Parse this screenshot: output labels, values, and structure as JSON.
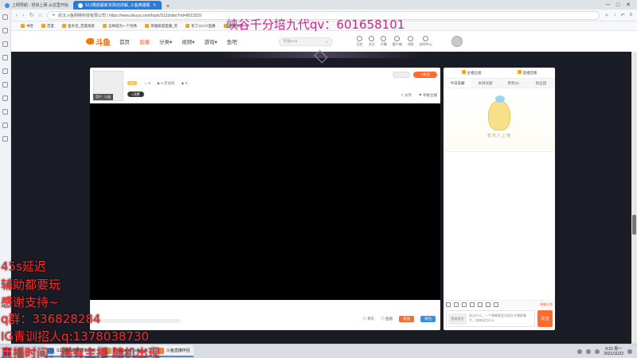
{
  "browser": {
    "tabs": [
      {
        "label": "上网导航 - 轻快上网 从这里开始",
        "active": false
      },
      {
        "label": "S12赛前最新本改动详解_斗鱼英雄联",
        "active": true
      }
    ],
    "new_tab": "+",
    "window_controls": [
      "─",
      "□",
      "✕"
    ],
    "url": "武汉斗鱼网络科技有限公司 | https://www.douyu.com/topic/S12zhibo?rid=8011529",
    "bookmarks": [
      "书签",
      "百度",
      "金木坚_百度搜索",
      "怎样成为一个优秀",
      "英雄联盟直播_英",
      "有了zzz'LT直播",
      "英雄联盟"
    ]
  },
  "overlay_title": "峡谷千分培九代qv：601658101",
  "site": {
    "logo": "斗鱼",
    "nav": [
      {
        "label": "首页",
        "active": false
      },
      {
        "label": "直播",
        "active": true
      },
      {
        "label": "分类▾",
        "active": false
      },
      {
        "label": "视频▾",
        "active": false
      },
      {
        "label": "游戏▾",
        "active": false
      },
      {
        "label": "鱼吧",
        "active": false
      }
    ],
    "search_placeholder": "阿福sma",
    "tools": [
      "历史",
      "关注",
      "开播",
      "客户端",
      "消息",
      "创作中心"
    ]
  },
  "player": {
    "host_tag": "用户",
    "host_tag2": "公益",
    "level": "LV.5",
    "stats": {
      "hot": "0",
      "followers": "0 次访问",
      "online": "0"
    },
    "vip_tag": "V消费",
    "follow_btn": "+关注",
    "share": "分享",
    "report": "举报主播",
    "foot": {
      "item1": "有礼",
      "item2": "鱼翅",
      "btn1": "充值",
      "btn2": "背包"
    }
  },
  "right_panel": {
    "top_left": "主播应援",
    "top_right": "直播回看",
    "tabs": [
      "今日贡献",
      "本周贡献",
      "贵宾(0)",
      "粉丝团"
    ],
    "rank_empty": "暂无人上榜",
    "gift_hint": "弹幕礼物",
    "input_badge": "登录发言",
    "input_text": "说点什么，一个弹幕就会出现在主播屏幕中，快来说点什么",
    "send": "发送"
  },
  "overlays": [
    "45s延迟",
    "辅助都要玩",
    "感谢支持~",
    "q群：336828284",
    "IG青训招人q:1378038730",
    "直播时间：稀有主播 随机出现"
  ],
  "taskbar": {
    "tasks": [
      {
        "label": "S12赛前最新版本改动",
        "icon": "browser"
      },
      {
        "label": "League of Legends",
        "icon": "lol"
      },
      {
        "label": "斗鱼直播伴侣",
        "icon": "douyu"
      }
    ],
    "time": "9:22 周一",
    "date": "2021/11/22"
  },
  "colors": {
    "accent": "#ff6a2f",
    "overlay_text": "#ff2a2a",
    "title_overlay": "#d21f8c",
    "tab_active": "#2a7bd8"
  }
}
